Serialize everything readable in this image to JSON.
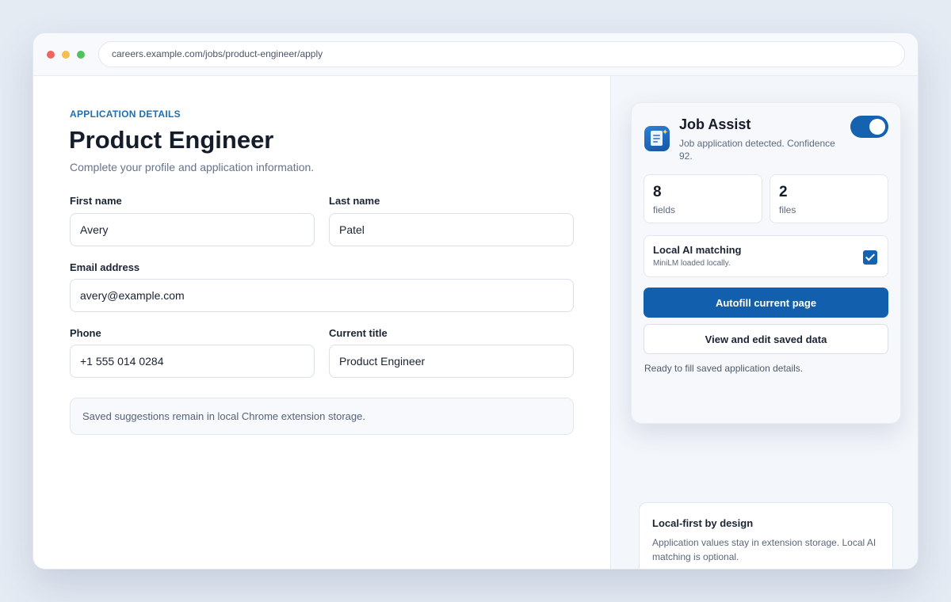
{
  "browser": {
    "url": "careers.example.com/jobs/product-engineer/apply"
  },
  "form": {
    "eyebrow": "APPLICATION DETAILS",
    "title": "Product Engineer",
    "subtitle": "Complete your profile and application information.",
    "fields": {
      "first_name": {
        "label": "First name",
        "value": "Avery"
      },
      "last_name": {
        "label": "Last name",
        "value": "Patel"
      },
      "email": {
        "label": "Email address",
        "value": "avery@example.com"
      },
      "phone": {
        "label": "Phone",
        "value": "+1 555 014 0284"
      },
      "current_title": {
        "label": "Current title",
        "value": "Product Engineer"
      }
    },
    "note": "Saved suggestions remain in local Chrome extension storage."
  },
  "extension": {
    "name": "Job Assist",
    "status": "Job application detected. Confidence 92.",
    "enabled": true,
    "stats": [
      {
        "value": "8",
        "unit": "fields"
      },
      {
        "value": "2",
        "unit": "files"
      }
    ],
    "ai_matching": {
      "title": "Local AI matching",
      "subtitle": "MiniLM loaded locally.",
      "checked": true
    },
    "autofill_label": "Autofill current page",
    "edit_label": "View and edit saved data",
    "ready_text": "Ready to fill saved application details.",
    "accent": "#1260ad"
  },
  "info": {
    "title": "Local-first by design",
    "body": "Application values stay in extension storage. Local AI matching is optional."
  }
}
